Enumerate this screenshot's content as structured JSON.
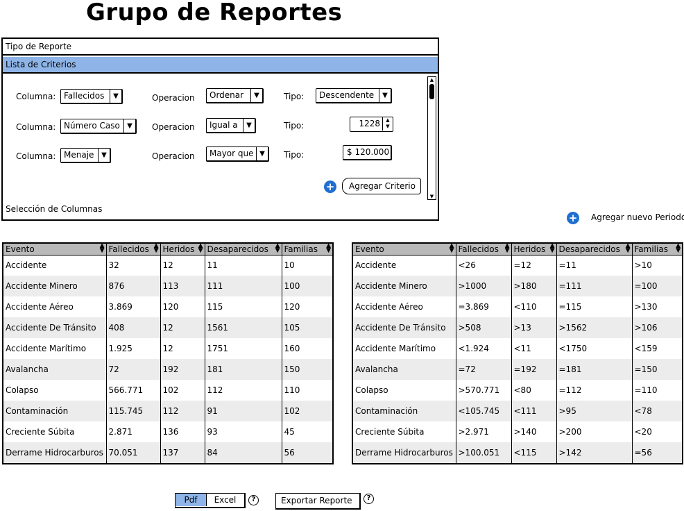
{
  "page": {
    "title": "Grupo de Reportes"
  },
  "accordion": {
    "sections": [
      "Tipo de Reporte",
      "Lista de Criterios",
      "Selección de Columnas"
    ],
    "criteria": [
      {
        "col_label": "Columna:",
        "col_value": "Fallecidos",
        "op_label": "Operacion",
        "op_value": "Ordenar",
        "tipo_label": "Tipo:",
        "tipo_value": "Descendente"
      },
      {
        "col_label": "Columna:",
        "col_value": "Número Caso",
        "op_label": "Operacion",
        "op_value": "Igual a",
        "tipo_label": "Tipo:",
        "tipo_value": "1228"
      },
      {
        "col_label": "Columna:",
        "col_value": "Menaje",
        "op_label": "Operacion",
        "op_value": "Mayor que",
        "tipo_label": "Tipo:",
        "tipo_value": "$ 120.000"
      }
    ],
    "add_criterio": "Agregar Criterio"
  },
  "add_periodo": "Agregar nuevo Periodo",
  "tables": [
    {
      "headers": [
        "Evento",
        "Fallecidos",
        "Heridos",
        "Desaparecidos",
        "Familias"
      ],
      "rows": [
        [
          "Accidente",
          "32",
          "12",
          "11",
          "10"
        ],
        [
          "Accidente Minero",
          "876",
          "113",
          "111",
          "100"
        ],
        [
          "Accidente Aéreo",
          "3.869",
          "120",
          "115",
          "120"
        ],
        [
          "Accidente De Tránsito",
          "408",
          "12",
          "1561",
          "105"
        ],
        [
          "Accidente Marítimo",
          "1.925",
          "12",
          "1751",
          "160"
        ],
        [
          "Avalancha",
          "72",
          "192",
          "181",
          "150"
        ],
        [
          "Colapso",
          "566.771",
          "102",
          "112",
          "110"
        ],
        [
          "Contaminación",
          "115.745",
          "112",
          "91",
          "102"
        ],
        [
          "Creciente Súbita",
          "2.871",
          "136",
          "93",
          "45"
        ],
        [
          "Derrame Hidrocarburos",
          "70.051",
          "137",
          "84",
          "56"
        ]
      ]
    },
    {
      "headers": [
        "Evento",
        "Fallecidos",
        "Heridos",
        "Desaparecidos",
        "Familias"
      ],
      "rows": [
        [
          "Accidente",
          "<26",
          "=12",
          "=11",
          ">10"
        ],
        [
          "Accidente Minero",
          ">1000",
          ">180",
          "=111",
          "=100"
        ],
        [
          "Accidente Aéreo",
          "=3.869",
          "<110",
          "=115",
          ">130"
        ],
        [
          "Accidente De Tránsito",
          ">508",
          ">13",
          ">1562",
          ">106"
        ],
        [
          "Accidente Marítimo",
          "<1.924",
          "<11",
          "<1750",
          "<159"
        ],
        [
          "Avalancha",
          "=72",
          "=192",
          "=181",
          "=150"
        ],
        [
          "Colapso",
          ">570.771",
          "<80",
          "=112",
          "=110"
        ],
        [
          "Contaminación",
          "<105.745",
          "<111",
          ">95",
          "<78"
        ],
        [
          "Creciente Súbita",
          ">2.971",
          ">140",
          ">200",
          "<20"
        ],
        [
          "Derrame Hidrocarburos",
          ">100.051",
          "<115",
          ">142",
          "=56"
        ]
      ]
    }
  ],
  "export": {
    "pdf": "Pdf",
    "excel": "Excel",
    "button": "Exportar Reporte",
    "help": "?"
  },
  "colors": {
    "selected": "#8fb5e8",
    "header_gray": "#b9b9b9",
    "plus_blue": "#1f6fd0"
  }
}
